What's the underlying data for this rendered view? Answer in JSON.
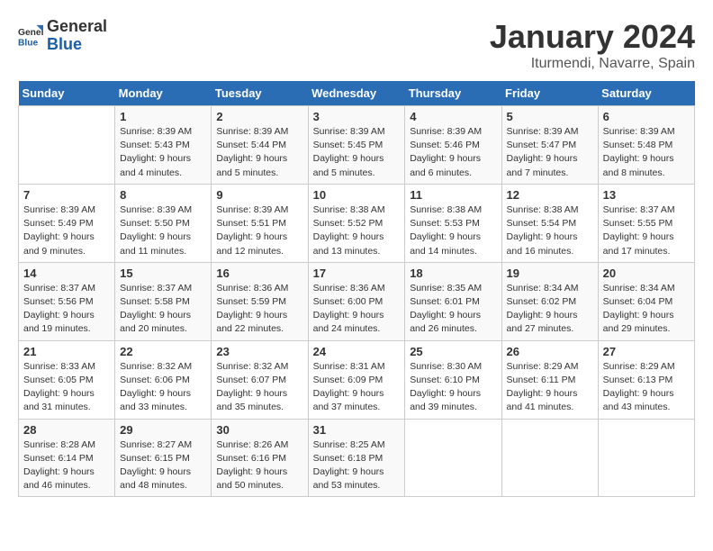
{
  "header": {
    "logo_general": "General",
    "logo_blue": "Blue",
    "month_title": "January 2024",
    "location": "Iturmendi, Navarre, Spain"
  },
  "days_of_week": [
    "Sunday",
    "Monday",
    "Tuesday",
    "Wednesday",
    "Thursday",
    "Friday",
    "Saturday"
  ],
  "weeks": [
    [
      {
        "day": "",
        "info": ""
      },
      {
        "day": "1",
        "info": "Sunrise: 8:39 AM\nSunset: 5:43 PM\nDaylight: 9 hours\nand 4 minutes."
      },
      {
        "day": "2",
        "info": "Sunrise: 8:39 AM\nSunset: 5:44 PM\nDaylight: 9 hours\nand 5 minutes."
      },
      {
        "day": "3",
        "info": "Sunrise: 8:39 AM\nSunset: 5:45 PM\nDaylight: 9 hours\nand 5 minutes."
      },
      {
        "day": "4",
        "info": "Sunrise: 8:39 AM\nSunset: 5:46 PM\nDaylight: 9 hours\nand 6 minutes."
      },
      {
        "day": "5",
        "info": "Sunrise: 8:39 AM\nSunset: 5:47 PM\nDaylight: 9 hours\nand 7 minutes."
      },
      {
        "day": "6",
        "info": "Sunrise: 8:39 AM\nSunset: 5:48 PM\nDaylight: 9 hours\nand 8 minutes."
      }
    ],
    [
      {
        "day": "7",
        "info": "Sunrise: 8:39 AM\nSunset: 5:49 PM\nDaylight: 9 hours\nand 9 minutes."
      },
      {
        "day": "8",
        "info": "Sunrise: 8:39 AM\nSunset: 5:50 PM\nDaylight: 9 hours\nand 11 minutes."
      },
      {
        "day": "9",
        "info": "Sunrise: 8:39 AM\nSunset: 5:51 PM\nDaylight: 9 hours\nand 12 minutes."
      },
      {
        "day": "10",
        "info": "Sunrise: 8:38 AM\nSunset: 5:52 PM\nDaylight: 9 hours\nand 13 minutes."
      },
      {
        "day": "11",
        "info": "Sunrise: 8:38 AM\nSunset: 5:53 PM\nDaylight: 9 hours\nand 14 minutes."
      },
      {
        "day": "12",
        "info": "Sunrise: 8:38 AM\nSunset: 5:54 PM\nDaylight: 9 hours\nand 16 minutes."
      },
      {
        "day": "13",
        "info": "Sunrise: 8:37 AM\nSunset: 5:55 PM\nDaylight: 9 hours\nand 17 minutes."
      }
    ],
    [
      {
        "day": "14",
        "info": "Sunrise: 8:37 AM\nSunset: 5:56 PM\nDaylight: 9 hours\nand 19 minutes."
      },
      {
        "day": "15",
        "info": "Sunrise: 8:37 AM\nSunset: 5:58 PM\nDaylight: 9 hours\nand 20 minutes."
      },
      {
        "day": "16",
        "info": "Sunrise: 8:36 AM\nSunset: 5:59 PM\nDaylight: 9 hours\nand 22 minutes."
      },
      {
        "day": "17",
        "info": "Sunrise: 8:36 AM\nSunset: 6:00 PM\nDaylight: 9 hours\nand 24 minutes."
      },
      {
        "day": "18",
        "info": "Sunrise: 8:35 AM\nSunset: 6:01 PM\nDaylight: 9 hours\nand 26 minutes."
      },
      {
        "day": "19",
        "info": "Sunrise: 8:34 AM\nSunset: 6:02 PM\nDaylight: 9 hours\nand 27 minutes."
      },
      {
        "day": "20",
        "info": "Sunrise: 8:34 AM\nSunset: 6:04 PM\nDaylight: 9 hours\nand 29 minutes."
      }
    ],
    [
      {
        "day": "21",
        "info": "Sunrise: 8:33 AM\nSunset: 6:05 PM\nDaylight: 9 hours\nand 31 minutes."
      },
      {
        "day": "22",
        "info": "Sunrise: 8:32 AM\nSunset: 6:06 PM\nDaylight: 9 hours\nand 33 minutes."
      },
      {
        "day": "23",
        "info": "Sunrise: 8:32 AM\nSunset: 6:07 PM\nDaylight: 9 hours\nand 35 minutes."
      },
      {
        "day": "24",
        "info": "Sunrise: 8:31 AM\nSunset: 6:09 PM\nDaylight: 9 hours\nand 37 minutes."
      },
      {
        "day": "25",
        "info": "Sunrise: 8:30 AM\nSunset: 6:10 PM\nDaylight: 9 hours\nand 39 minutes."
      },
      {
        "day": "26",
        "info": "Sunrise: 8:29 AM\nSunset: 6:11 PM\nDaylight: 9 hours\nand 41 minutes."
      },
      {
        "day": "27",
        "info": "Sunrise: 8:29 AM\nSunset: 6:13 PM\nDaylight: 9 hours\nand 43 minutes."
      }
    ],
    [
      {
        "day": "28",
        "info": "Sunrise: 8:28 AM\nSunset: 6:14 PM\nDaylight: 9 hours\nand 46 minutes."
      },
      {
        "day": "29",
        "info": "Sunrise: 8:27 AM\nSunset: 6:15 PM\nDaylight: 9 hours\nand 48 minutes."
      },
      {
        "day": "30",
        "info": "Sunrise: 8:26 AM\nSunset: 6:16 PM\nDaylight: 9 hours\nand 50 minutes."
      },
      {
        "day": "31",
        "info": "Sunrise: 8:25 AM\nSunset: 6:18 PM\nDaylight: 9 hours\nand 53 minutes."
      },
      {
        "day": "",
        "info": ""
      },
      {
        "day": "",
        "info": ""
      },
      {
        "day": "",
        "info": ""
      }
    ]
  ]
}
